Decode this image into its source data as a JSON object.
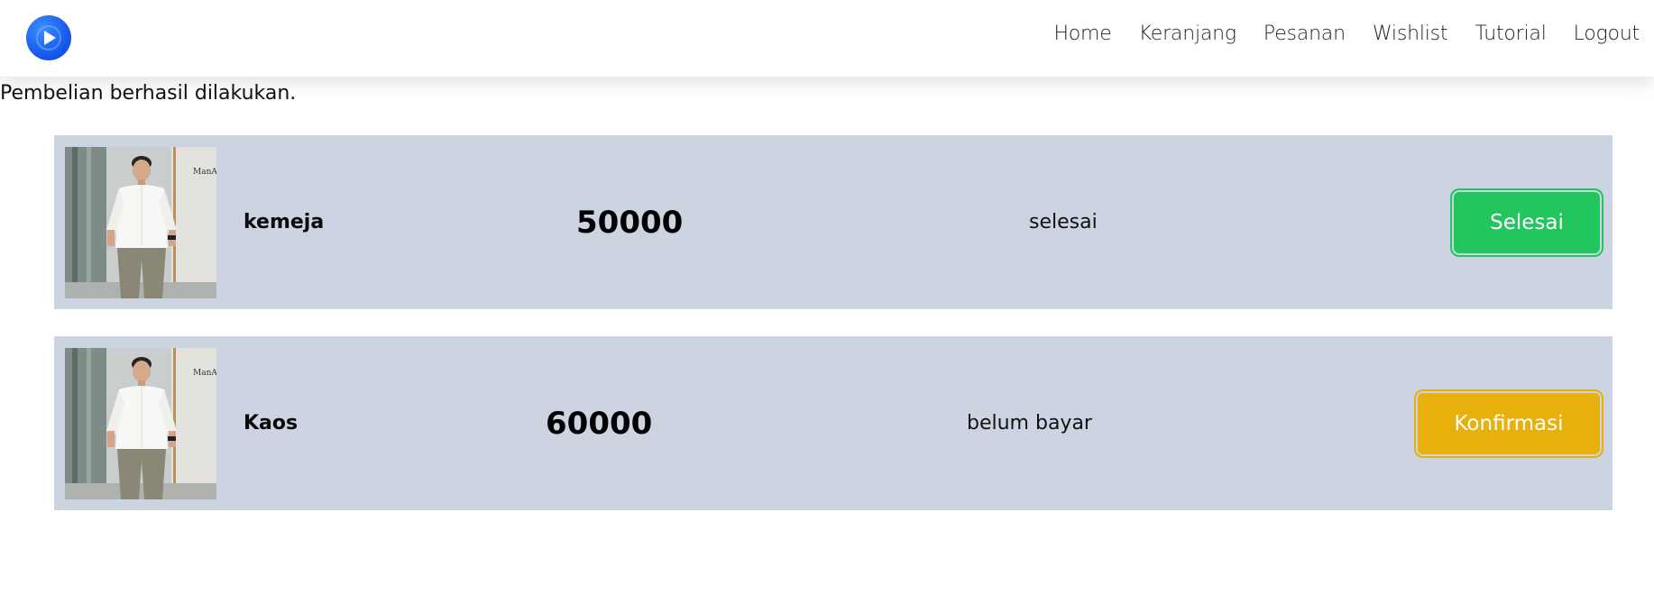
{
  "nav": {
    "logo_icon": "play-logo-icon",
    "links": [
      "Home",
      "Keranjang",
      "Pesanan",
      "Wishlist",
      "Tutorial",
      "Logout"
    ]
  },
  "flash_message": "Pembelian berhasil dilakukan.",
  "orders": [
    {
      "name": "kemeja",
      "price": "50000",
      "status": "selesai",
      "action": "Selesai",
      "action_color": "#22c55e",
      "image": "product-photo-man-white-shirt"
    },
    {
      "name": "Kaos",
      "price": "60000",
      "status": "belum bayar",
      "action": "Konfirmasi",
      "action_color": "#e8b00b",
      "image": "product-photo-man-white-shirt"
    }
  ],
  "colors": {
    "row_background": "#cbd4e0",
    "accent_logo": "#1a5ff0"
  }
}
